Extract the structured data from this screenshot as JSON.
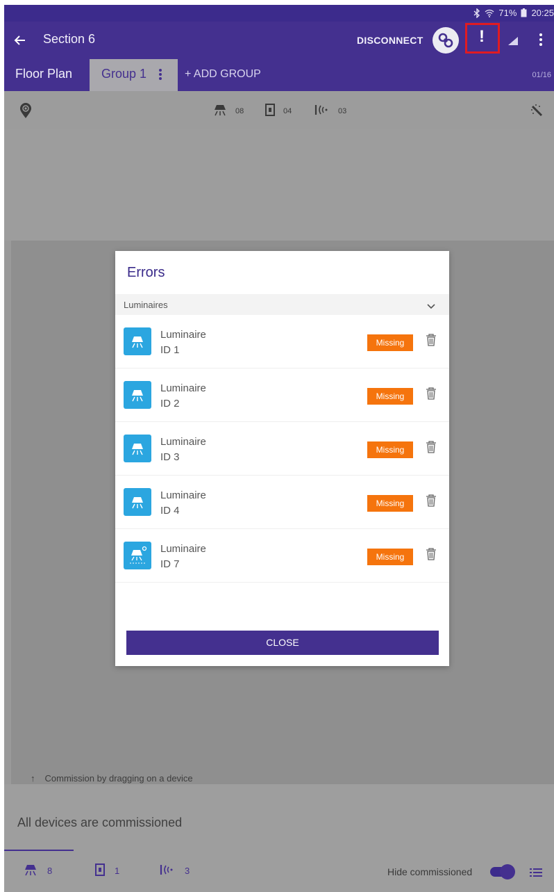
{
  "status_bar": {
    "battery": "71%",
    "time": "20:25"
  },
  "app_bar": {
    "title": "Section 6",
    "disconnect_label": "DISCONNECT",
    "alert_symbol": "!"
  },
  "tabs": {
    "floor_plan": "Floor Plan",
    "group": "Group 1",
    "add_group": "+ ADD GROUP",
    "page_count": "01/16"
  },
  "device_summary": {
    "luminaires": "08",
    "switches": "04",
    "sensors": "03"
  },
  "hint": {
    "arrow": "↑",
    "text": "Commission by dragging on a device"
  },
  "commission_status": "All devices are commissioned",
  "bottom_bar": {
    "luminaires": "8",
    "switches": "1",
    "sensors": "3",
    "hide_label": "Hide commissioned",
    "hide_commissioned": true
  },
  "dialog": {
    "title": "Errors",
    "section_label": "Luminaires",
    "items": [
      {
        "name": "Luminaire",
        "id": "ID 1",
        "status": "Missing",
        "icon": "luminaire-icon"
      },
      {
        "name": "Luminaire",
        "id": "ID 2",
        "status": "Missing",
        "icon": "luminaire-icon"
      },
      {
        "name": "Luminaire",
        "id": "ID 3",
        "status": "Missing",
        "icon": "luminaire-icon"
      },
      {
        "name": "Luminaire",
        "id": "ID 4",
        "status": "Missing",
        "icon": "luminaire-icon"
      },
      {
        "name": "Luminaire",
        "id": "ID 7",
        "status": "Missing",
        "icon": "luminaire-sensor-icon"
      }
    ],
    "close_label": "CLOSE"
  },
  "colors": {
    "primary": "#44308f",
    "accent_missing": "#f5740d",
    "device_icon": "#2ba6e0",
    "highlight": "#e01b22"
  }
}
